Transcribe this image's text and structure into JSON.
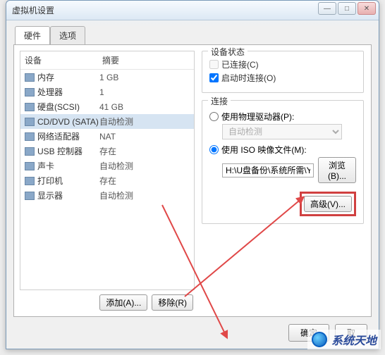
{
  "window": {
    "title": "虚拟机设置"
  },
  "tabs": {
    "hardware": "硬件",
    "options": "选项"
  },
  "hw_header": {
    "device": "设备",
    "summary": "摘要"
  },
  "hw": [
    {
      "icon": "memory-icon",
      "name": "内存",
      "summary": "1 GB"
    },
    {
      "icon": "cpu-icon",
      "name": "处理器",
      "summary": "1"
    },
    {
      "icon": "disk-icon",
      "name": "硬盘(SCSI)",
      "summary": "41 GB"
    },
    {
      "icon": "cd-icon",
      "name": "CD/DVD (SATA)",
      "summary": "自动检测"
    },
    {
      "icon": "net-icon",
      "name": "网络适配器",
      "summary": "NAT"
    },
    {
      "icon": "usb-icon",
      "name": "USB 控制器",
      "summary": "存在"
    },
    {
      "icon": "sound-icon",
      "name": "声卡",
      "summary": "自动检测"
    },
    {
      "icon": "printer-icon",
      "name": "打印机",
      "summary": "存在"
    },
    {
      "icon": "display-icon",
      "name": "显示器",
      "summary": "自动检测"
    }
  ],
  "hw_selected_index": 3,
  "hw_buttons": {
    "add": "添加(A)...",
    "remove": "移除(R)"
  },
  "status": {
    "title": "设备状态",
    "connected": "已连接(C)",
    "connect_at_poweron": "启动时连接(O)",
    "connected_checked": false,
    "connected_enabled": false,
    "poweron_checked": true
  },
  "connection": {
    "title": "连接",
    "use_physical": "使用物理驱动器(P):",
    "physical_value": "自动检测",
    "use_iso": "使用 ISO 映像文件(M):",
    "iso_path": "H:\\U盘备份\\系统所需\\YLMF_",
    "browse": "浏览(B)...",
    "advanced": "高级(V)...",
    "selected": "iso"
  },
  "footer": {
    "ok": "确定",
    "cancel": "取"
  },
  "watermark": "系统天地"
}
